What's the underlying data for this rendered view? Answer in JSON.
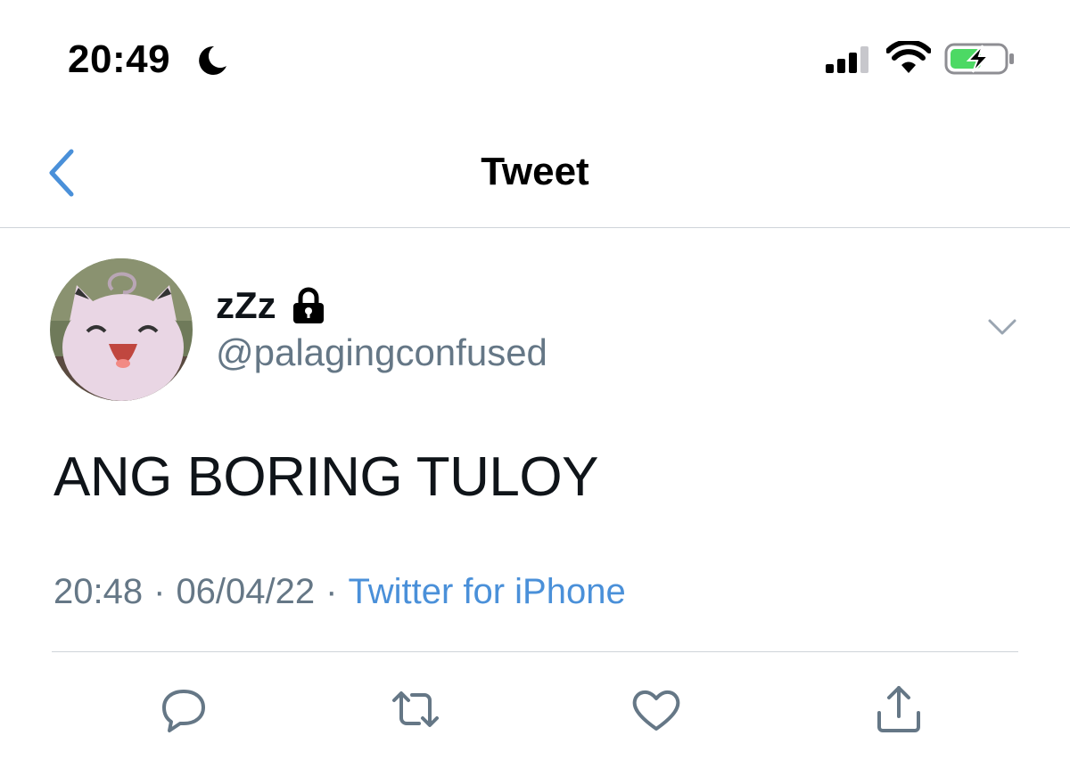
{
  "status_bar": {
    "time": "20:49",
    "icons": [
      "moon-icon",
      "cellular-signal-icon",
      "wifi-icon",
      "battery-charging-icon"
    ],
    "battery_color": "#4cd964"
  },
  "nav": {
    "title": "Tweet",
    "back_icon": "chevron-left-icon",
    "accent_color": "#4a90d9"
  },
  "tweet": {
    "display_name": "zZz",
    "protected_icon": "lock-icon",
    "handle": "@palagingconfused",
    "text": "ANG BORING TULOY",
    "time": "20:48",
    "date": "06/04/22",
    "separator": "·",
    "source": "Twitter for iPhone"
  },
  "actions": [
    {
      "name": "reply",
      "icon": "reply-icon"
    },
    {
      "name": "retweet",
      "icon": "retweet-icon"
    },
    {
      "name": "like",
      "icon": "heart-icon"
    },
    {
      "name": "share",
      "icon": "share-icon"
    }
  ]
}
